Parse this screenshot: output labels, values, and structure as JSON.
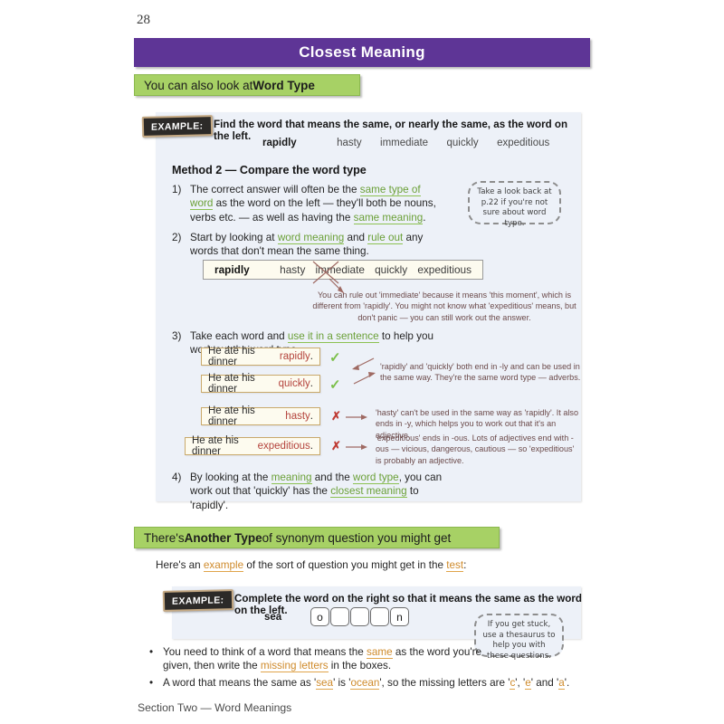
{
  "page": {
    "number": "28",
    "title": "Closest Meaning",
    "footer": "Section Two — Word Meanings"
  },
  "colors": {
    "header_purple": "#5E3596",
    "heading_green": "#A7D165",
    "panel_blue": "#EDF1F8",
    "link_green": "#6BA038",
    "link_orange": "#CF8B2C",
    "tick_green": "#7BBF4A",
    "cross_red": "#BF3B34",
    "word_red": "#B4433C"
  },
  "section1": {
    "heading_plain": "You can also look at ",
    "heading_bold": "Word Type",
    "example": {
      "tag": "EXAMPLE:",
      "instruction": "Find the word that means the same, or nearly the same, as the word on the left.",
      "question_word": "rapidly",
      "options": [
        "hasty",
        "immediate",
        "quickly",
        "expeditious"
      ],
      "method_heading": "Method 2 — Compare the word type",
      "steps": [
        {
          "num": "1)",
          "parts": [
            {
              "t": "The correct answer will often be the ",
              "s": "plain"
            },
            {
              "t": "same type of word",
              "s": "green"
            },
            {
              "t": " as the word on the left — they'll both be nouns, verbs etc. — as well as having the ",
              "s": "plain"
            },
            {
              "t": "same meaning",
              "s": "green"
            },
            {
              "t": ".",
              "s": "plain"
            }
          ]
        },
        {
          "num": "2)",
          "parts": [
            {
              "t": "Start by looking at ",
              "s": "plain"
            },
            {
              "t": "word meaning",
              "s": "green"
            },
            {
              "t": " and ",
              "s": "plain"
            },
            {
              "t": "rule out",
              "s": "green"
            },
            {
              "t": " any words that don't mean the same thing.",
              "s": "plain"
            }
          ]
        },
        {
          "num": "3)",
          "parts": [
            {
              "t": "Take each word and ",
              "s": "plain"
            },
            {
              "t": "use it in a sentence",
              "s": "green"
            },
            {
              "t": " to help you work out the word type.",
              "s": "plain"
            }
          ]
        },
        {
          "num": "4)",
          "parts": [
            {
              "t": "By looking at the ",
              "s": "plain"
            },
            {
              "t": "meaning",
              "s": "green"
            },
            {
              "t": " and the ",
              "s": "plain"
            },
            {
              "t": "word type",
              "s": "green"
            },
            {
              "t": ", you can work out that 'quickly' has the ",
              "s": "plain"
            },
            {
              "t": "closest meaning",
              "s": "green"
            },
            {
              "t": " to 'rapidly'.",
              "s": "plain"
            }
          ]
        }
      ],
      "note": "Take a look back at p.22 if you're not sure about word type.",
      "wordbank": {
        "lead": "rapidly",
        "options": [
          "hasty",
          "immediate",
          "quickly",
          "expeditious"
        ],
        "crossed_out": "immediate"
      },
      "ruleout_annotation": "You can rule out 'immediate' because it means 'this moment', which is different from 'rapidly'.  You might not know what 'expeditious' means, but don't panic — you can still work out the answer.",
      "sentences": [
        {
          "before": "He ate his dinner ",
          "word": "rapidly",
          "after": ".",
          "mark": "tick"
        },
        {
          "before": "He ate his dinner ",
          "word": "quickly",
          "after": ".",
          "mark": "tick"
        },
        {
          "before": "He ate his dinner ",
          "word": "hasty",
          "after": ".",
          "mark": "cross"
        },
        {
          "before": "He ate his dinner ",
          "word": "expeditious",
          "after": ".",
          "mark": "cross"
        }
      ],
      "sentence_notes": [
        "'rapidly' and 'quickly' both end in -ly and can be used in the same way. They're the same word type — adverbs.",
        "'hasty' can't be used in the same way as 'rapidly'.  It also ends in -y, which helps you to work out that it's an adjective.",
        "'expeditious' ends in -ous.  Lots of adjectives end with -ous — vicious, dangerous, cautious — so 'expeditious' is probably an adjective."
      ],
      "marks": {
        "tick": "✓",
        "cross": "✗"
      }
    }
  },
  "section2": {
    "heading_pre": "There's ",
    "heading_bold": "Another Type",
    "heading_post": " of synonym question you might get",
    "intro": [
      {
        "t": "Here's an ",
        "s": "plain"
      },
      {
        "t": "example",
        "s": "orange"
      },
      {
        "t": " of the sort of question you might get in the ",
        "s": "plain"
      },
      {
        "t": "test",
        "s": "orange"
      },
      {
        "t": ":",
        "s": "plain"
      }
    ],
    "example": {
      "tag": "EXAMPLE:",
      "instruction": "Complete the word on the right so that it means the same as the word on the left.",
      "prompt_word": "sea",
      "letter_boxes": [
        "o",
        "",
        "",
        "",
        "n"
      ],
      "note": "If you get stuck, use a thesaurus to help you with these questions."
    },
    "bullets": [
      [
        {
          "t": "You need to think of a word that means the ",
          "s": "plain"
        },
        {
          "t": "same",
          "s": "orange"
        },
        {
          "t": " as the word you're given, then write the ",
          "s": "plain"
        },
        {
          "t": "missing letters",
          "s": "orange"
        },
        {
          "t": " in the boxes.",
          "s": "plain"
        }
      ],
      [
        {
          "t": "A word that means the same as '",
          "s": "plain"
        },
        {
          "t": "sea",
          "s": "orange"
        },
        {
          "t": "' is '",
          "s": "plain"
        },
        {
          "t": "ocean",
          "s": "orange"
        },
        {
          "t": "', so the missing letters are '",
          "s": "plain"
        },
        {
          "t": "c",
          "s": "orange"
        },
        {
          "t": "', '",
          "s": "plain"
        },
        {
          "t": "e",
          "s": "orange"
        },
        {
          "t": "' and '",
          "s": "plain"
        },
        {
          "t": "a",
          "s": "orange"
        },
        {
          "t": "'.",
          "s": "plain"
        }
      ]
    ],
    "bullet_char": "•"
  }
}
